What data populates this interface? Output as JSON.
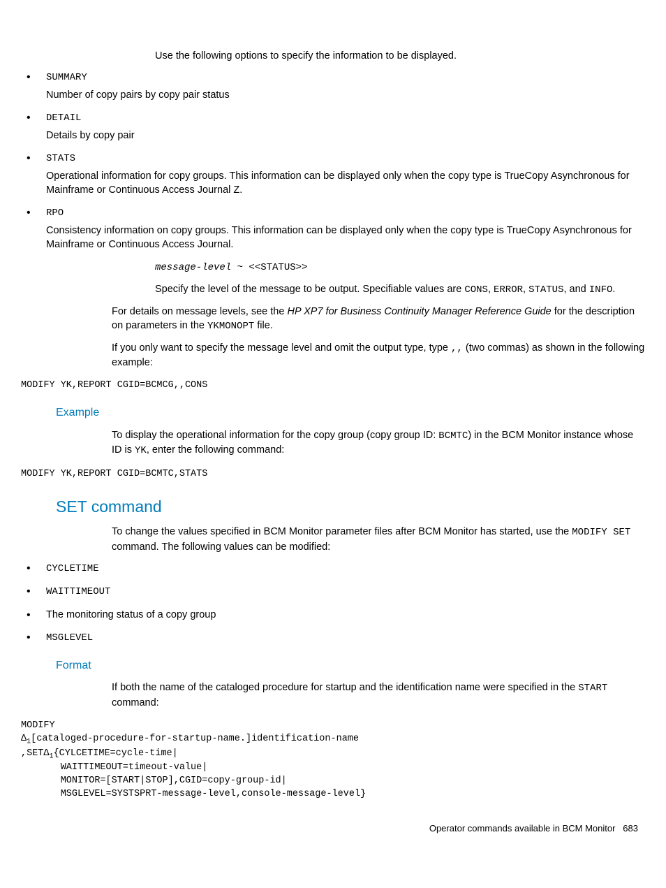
{
  "intro_para": "Use the following options to specify the information to be displayed.",
  "options": {
    "summary_label": "SUMMARY",
    "summary_desc": "Number of copy pairs by copy pair status",
    "detail_label": "DETAIL",
    "detail_desc": "Details by copy pair",
    "stats_label": "STATS",
    "stats_desc": "Operational information for copy groups. This information can be displayed only when the copy type is TrueCopy Asynchronous for Mainframe or Continuous Access Journal Z.",
    "rpo_label": "RPO",
    "rpo_desc": "Consistency information on copy groups. This information can be displayed only when the copy type is TrueCopy Asynchronous for Mainframe or Continuous Access Journal."
  },
  "msg_level": {
    "sig_var": "message-level",
    "sig_rest": " ~ <<STATUS>>",
    "desc_pre": "Specify the level of the message to be output. Specifiable values are ",
    "v_cons": "CONS",
    "v_error": "ERROR",
    "v_status": "STATUS",
    "and": ", and ",
    "v_info": "INFO",
    "period": "."
  },
  "details_para": {
    "pre": "For details on message levels, see the ",
    "ref": "HP XP7 for Business Continuity Manager Reference Guide",
    "mid": " for the description on parameters in the ",
    "file": "YKMONOPT",
    "post": " file."
  },
  "only_para": {
    "pre": "If you only want to specify the message level and omit the output type, type ",
    "commas": ",,",
    "post": " (two commas) as shown in the following example:"
  },
  "code1": "MODIFY YK,REPORT CGID=BCMCG,,CONS",
  "example_heading": "Example",
  "example_para": {
    "pre": "To display the operational information for the copy group (copy group ID: ",
    "cgid": "BCMTC",
    "mid": ") in the BCM Monitor instance whose ID is ",
    "id": "YK",
    "post": ", enter the following command:"
  },
  "code2": "MODIFY YK,REPORT CGID=BCMTC,STATS",
  "set_heading": "SET command",
  "set_para": {
    "pre": "To change the values specified in BCM Monitor parameter files after BCM Monitor has started, use the ",
    "cmd": "MODIFY SET",
    "post": " command. The following values can be modified:"
  },
  "set_items": {
    "i1": "CYCLETIME",
    "i2": "WAITTIMEOUT",
    "i3": "The monitoring status of a copy group",
    "i4": "MSGLEVEL"
  },
  "format_heading": "Format",
  "format_para": {
    "pre": "If both the name of the cataloged procedure for startup and the identification name were specified in the ",
    "cmd": "START",
    "post": " command:"
  },
  "code3": {
    "l1": "MODIFY",
    "l2a": "[cataloged-procedure-for-startup-name.]identification-name",
    "l3a": ",SET",
    "l3b": "{CYLCETIME=cycle-time|",
    "l4": "       WAITTIMEOUT=timeout-value|",
    "l5": "       MONITOR=[START|STOP],CGID=copy-group-id|",
    "l6": "       MSGLEVEL=SYSTSPRT-message-level,console-message-level}"
  },
  "footer": {
    "text": "Operator commands available in BCM Monitor",
    "page": "683"
  }
}
